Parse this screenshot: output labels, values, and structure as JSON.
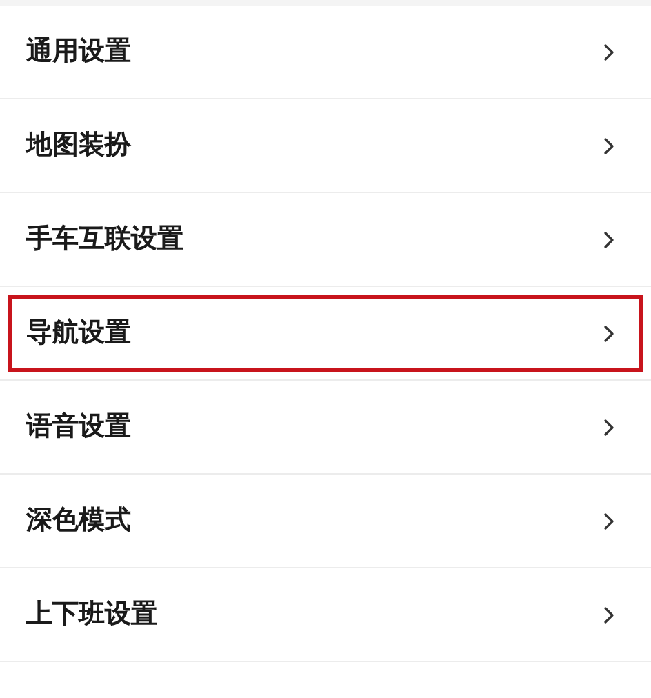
{
  "settings": [
    {
      "label": "通用设置",
      "highlighted": false
    },
    {
      "label": "地图装扮",
      "highlighted": false
    },
    {
      "label": "手车互联设置",
      "highlighted": false
    },
    {
      "label": "导航设置",
      "highlighted": true
    },
    {
      "label": "语音设置",
      "highlighted": false
    },
    {
      "label": "深色模式",
      "highlighted": false
    },
    {
      "label": "上下班设置",
      "highlighted": false
    }
  ]
}
